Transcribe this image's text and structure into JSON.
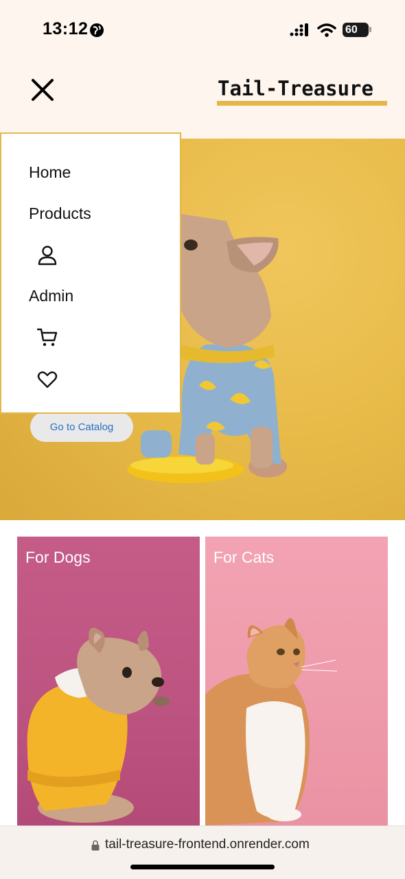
{
  "status": {
    "time": "13:12",
    "battery": "60"
  },
  "header": {
    "brand": "Tail-Treasure",
    "accent": "#e3b849"
  },
  "menu": {
    "items": [
      {
        "label": "Home",
        "type": "text"
      },
      {
        "label": "Products",
        "type": "text"
      },
      {
        "icon": "user-icon",
        "type": "icon"
      },
      {
        "label": "Admin",
        "type": "text"
      },
      {
        "icon": "cart-icon",
        "type": "icon"
      },
      {
        "icon": "heart-icon",
        "type": "icon"
      }
    ]
  },
  "hero": {
    "cta_label": "Go to Catalog",
    "background": "#e8bb49"
  },
  "categories": [
    {
      "label": "For Dogs",
      "color": "#c55c88"
    },
    {
      "label": "For Cats",
      "color": "#f2a3b3"
    }
  ],
  "browser": {
    "url": "tail-treasure-frontend.onrender.com"
  }
}
